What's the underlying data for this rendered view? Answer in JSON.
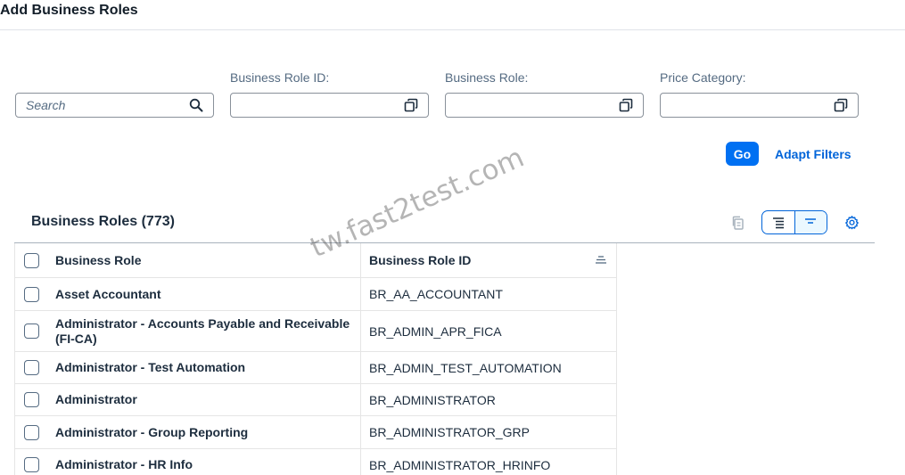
{
  "title": "Add Business Roles",
  "filters": {
    "search_placeholder": "Search",
    "business_role_id_label": "Business Role ID:",
    "business_role_label": "Business Role:",
    "price_category_label": "Price Category:",
    "go_label": "Go",
    "adapt_filters_label": "Adapt Filters"
  },
  "table": {
    "title": "Business Roles (773)",
    "columns": [
      "Business Role",
      "Business Role ID"
    ],
    "rows": [
      {
        "role": "Asset Accountant",
        "id": "BR_AA_ACCOUNTANT"
      },
      {
        "role": "Administrator - Accounts Payable and Receivable (FI-CA)",
        "id": "BR_ADMIN_APR_FICA"
      },
      {
        "role": "Administrator - Test Automation",
        "id": "BR_ADMIN_TEST_AUTOMATION"
      },
      {
        "role": "Administrator",
        "id": "BR_ADMINISTRATOR"
      },
      {
        "role": "Administrator - Group Reporting",
        "id": "BR_ADMINISTRATOR_GRP"
      },
      {
        "role": "Administrator - HR Info",
        "id": "BR_ADMINISTRATOR_HRINFO"
      }
    ]
  },
  "watermark": "tw.fast2test.com",
  "icons": {
    "search": "search-icon",
    "value_help": "value-help-icon",
    "copy": "copy-icon",
    "expand": "expand-rows-icon",
    "collapse": "collapse-rows-icon",
    "settings": "gear-icon",
    "column_menu": "column-menu-icon"
  },
  "colors": {
    "accent": "#0070f2",
    "link": "#0064d9",
    "text": "#1d2d3e",
    "label": "#556b82"
  }
}
